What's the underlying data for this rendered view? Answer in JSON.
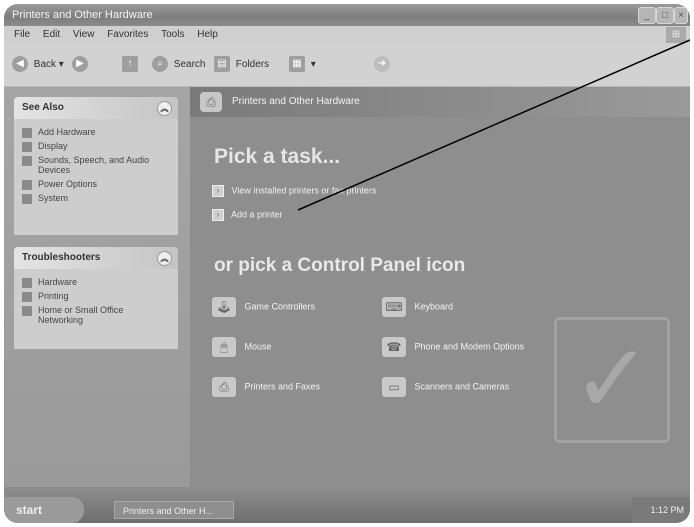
{
  "window": {
    "title": "Printers and Other Hardware",
    "controls": [
      "_",
      "□",
      "×"
    ]
  },
  "menubar": [
    "File",
    "Edit",
    "View",
    "Favorites",
    "Tools",
    "Help"
  ],
  "toolbar": {
    "back": "Back",
    "search": "Search",
    "folders": "Folders"
  },
  "left_panels": {
    "see_also": {
      "title": "See Also",
      "items": [
        "Add Hardware",
        "Display",
        "Sounds, Speech, and Audio Devices",
        "Power Options",
        "System"
      ]
    },
    "troubleshooters": {
      "title": "Troubleshooters",
      "items": [
        "Hardware",
        "Printing",
        "Home or Small Office Networking"
      ]
    }
  },
  "main": {
    "banner": "Printers and Other Hardware",
    "pick_task": "Pick a task...",
    "tasks": [
      "View installed printers or fax printers",
      "Add a printer"
    ],
    "or_pick": "or pick a Control Panel icon",
    "icons": [
      "Game Controllers",
      "Keyboard",
      "Mouse",
      "Phone and Modem Options",
      "Printers and Faxes",
      "Scanners and Cameras"
    ]
  },
  "taskbar": {
    "start": "start",
    "task": "Printers and Other H...",
    "clock": "1:12 PM"
  }
}
